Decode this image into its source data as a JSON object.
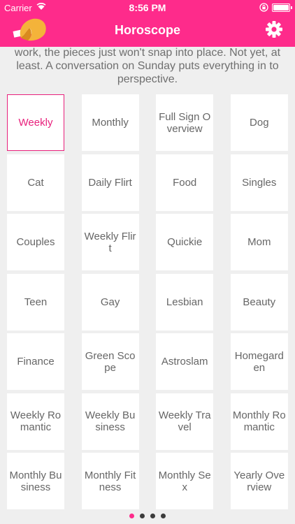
{
  "status_bar": {
    "carrier": "Carrier",
    "time": "8:56 PM"
  },
  "header": {
    "title": "Horoscope"
  },
  "horoscope_text": "work, the pieces just won't snap into place. Not yet, at least. A conversation on Sunday puts everything in to perspective.",
  "categories": [
    {
      "label": "Weekly",
      "selected": true
    },
    {
      "label": "Monthly"
    },
    {
      "label": "Full Sign Overview"
    },
    {
      "label": "Dog"
    },
    {
      "label": "Cat"
    },
    {
      "label": "Daily Flirt"
    },
    {
      "label": "Food"
    },
    {
      "label": "Singles"
    },
    {
      "label": "Couples"
    },
    {
      "label": "Weekly Flirt"
    },
    {
      "label": "Quickie"
    },
    {
      "label": "Mom"
    },
    {
      "label": "Teen"
    },
    {
      "label": "Gay"
    },
    {
      "label": "Lesbian"
    },
    {
      "label": "Beauty"
    },
    {
      "label": "Finance"
    },
    {
      "label": "Green Scope"
    },
    {
      "label": "Astroslam"
    },
    {
      "label": "Homegarden"
    },
    {
      "label": "Weekly Romantic"
    },
    {
      "label": "Weekly Business"
    },
    {
      "label": "Weekly Travel"
    },
    {
      "label": "Monthly Romantic"
    },
    {
      "label": "Monthly Business"
    },
    {
      "label": "Monthly Fitness"
    },
    {
      "label": "Monthly Sex"
    },
    {
      "label": "Yearly Overview"
    }
  ],
  "pager": {
    "count": 4,
    "active_index": 0
  },
  "colors": {
    "accent": "#fe2b8b",
    "selected_text": "#e8207c",
    "tile_text": "#666666",
    "background": "#efefef"
  },
  "icons": {
    "logo": "fortune-cookie-icon",
    "settings": "gear-icon",
    "wifi": "wifi-icon",
    "battery": "battery-icon",
    "lock": "orientation-lock-icon"
  }
}
